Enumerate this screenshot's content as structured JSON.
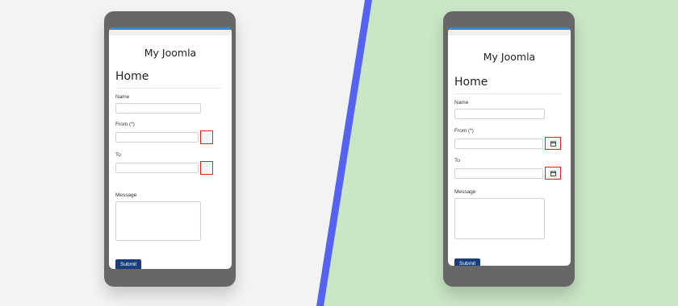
{
  "site_title": "My Joomla",
  "page_heading": "Home",
  "form": {
    "name_label": "Name",
    "from_label": "From (*)",
    "to_label": "To",
    "message_label": "Message",
    "submit_label": "Submit"
  },
  "colors": {
    "left_background": "#f3f3f3",
    "right_background": "#c9e6c5",
    "divider": "#5563f0",
    "highlight": "#e0241c",
    "submit_button": "#173e7a",
    "topbar_accent": "#2f89d8"
  },
  "icons": {
    "date_picker": "calendar-icon"
  }
}
